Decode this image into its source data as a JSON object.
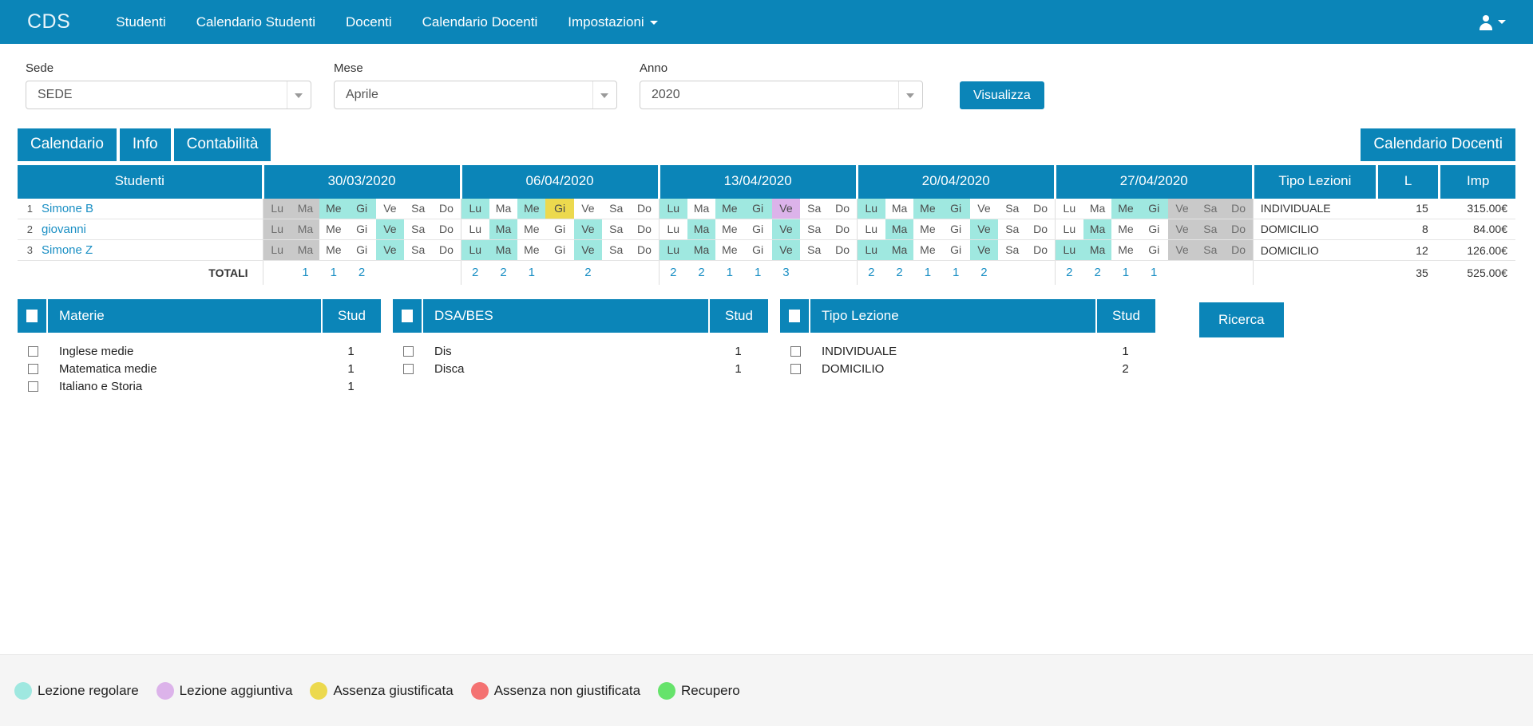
{
  "navbar": {
    "brand": "CDS",
    "links": [
      {
        "label": "Studenti",
        "caret": false
      },
      {
        "label": "Calendario Studenti",
        "caret": false
      },
      {
        "label": "Docenti",
        "caret": false
      },
      {
        "label": "Calendario Docenti",
        "caret": false
      },
      {
        "label": "Impostazioni",
        "caret": true
      }
    ],
    "user_icon": "user-icon"
  },
  "filters": {
    "sede": {
      "label": "Sede",
      "value": "SEDE"
    },
    "mese": {
      "label": "Mese",
      "value": "Aprile"
    },
    "anno": {
      "label": "Anno",
      "value": "2020"
    },
    "visualizza_label": "Visualizza"
  },
  "tabs": {
    "items": [
      {
        "label": "Calendario",
        "name": "tab-calendario"
      },
      {
        "label": "Info",
        "name": "tab-info"
      },
      {
        "label": "Contabilità",
        "name": "tab-contabilita"
      }
    ],
    "right_label": "Calendario Docenti"
  },
  "calendar": {
    "headers": {
      "studenti": "Studenti",
      "weeks": [
        "30/03/2020",
        "06/04/2020",
        "13/04/2020",
        "20/04/2020",
        "27/04/2020"
      ],
      "tipo": "Tipo Lezioni",
      "l": "L",
      "imp": "Imp"
    },
    "day_labels": [
      "Lu",
      "Ma",
      "Me",
      "Gi",
      "Ve",
      "Sa",
      "Do"
    ],
    "rows": [
      {
        "index": "1",
        "name": "Simone B",
        "tipo": "INDIVIDUALE",
        "l": "15",
        "imp": "315.00€",
        "weeks": [
          [
            "g",
            "g",
            "t",
            "t",
            "",
            "",
            ""
          ],
          [
            "t",
            "",
            "t",
            "y",
            "",
            "",
            ""
          ],
          [
            "t",
            "",
            "t",
            "t",
            "p",
            "",
            ""
          ],
          [
            "t",
            "",
            "t",
            "t",
            "",
            "",
            ""
          ],
          [
            "",
            "",
            "t",
            "t",
            "g",
            "g",
            "g"
          ]
        ]
      },
      {
        "index": "2",
        "name": "giovanni",
        "tipo": "DOMICILIO",
        "l": "8",
        "imp": "84.00€",
        "weeks": [
          [
            "g",
            "g",
            "",
            "",
            "t",
            "",
            ""
          ],
          [
            "",
            "t",
            "",
            "",
            "t",
            "",
            ""
          ],
          [
            "",
            "t",
            "",
            "",
            "t",
            "",
            ""
          ],
          [
            "",
            "t",
            "",
            "",
            "t",
            "",
            ""
          ],
          [
            "",
            "t",
            "",
            "",
            "g",
            "g",
            "g"
          ]
        ]
      },
      {
        "index": "3",
        "name": "Simone Z",
        "tipo": "DOMICILIO",
        "l": "12",
        "imp": "126.00€",
        "weeks": [
          [
            "g",
            "g",
            "",
            "",
            "t",
            "",
            ""
          ],
          [
            "t",
            "t",
            "",
            "",
            "t",
            "",
            ""
          ],
          [
            "t",
            "t",
            "",
            "",
            "t",
            "",
            ""
          ],
          [
            "t",
            "t",
            "",
            "",
            "t",
            "",
            ""
          ],
          [
            "t",
            "t",
            "",
            "",
            "g",
            "g",
            "g"
          ]
        ]
      }
    ],
    "totals": {
      "label": "TOTALI",
      "weeks": [
        [
          "",
          "1",
          "1",
          "2",
          "",
          "",
          ""
        ],
        [
          "2",
          "2",
          "1",
          "",
          "2",
          "",
          ""
        ],
        [
          "2",
          "2",
          "1",
          "1",
          "3",
          "",
          ""
        ],
        [
          "2",
          "2",
          "1",
          "1",
          "2",
          "",
          ""
        ],
        [
          "2",
          "2",
          "1",
          "1",
          "",
          "",
          ""
        ]
      ],
      "l": "35",
      "imp": "525.00€"
    }
  },
  "panels": [
    {
      "name": "materie",
      "title": "Materie",
      "stud_label": "Stud",
      "rows": [
        {
          "label": "Inglese medie",
          "count": "1"
        },
        {
          "label": "Matematica medie",
          "count": "1"
        },
        {
          "label": "Italiano e Storia",
          "count": "1"
        }
      ]
    },
    {
      "name": "dsa-bes",
      "title": "DSA/BES",
      "stud_label": "Stud",
      "rows": [
        {
          "label": "Dis",
          "count": "1"
        },
        {
          "label": "Disca",
          "count": "1"
        }
      ]
    },
    {
      "name": "tipo-lezione",
      "title": "Tipo Lezione",
      "stud_label": "Stud",
      "rows": [
        {
          "label": "INDIVIDUALE",
          "count": "1"
        },
        {
          "label": "DOMICILIO",
          "count": "2"
        }
      ]
    }
  ],
  "ricerca_label": "Ricerca",
  "legend": [
    {
      "label": "Lezione regolare",
      "color": "#9fe8e0"
    },
    {
      "label": "Lezione aggiuntiva",
      "color": "#dcb3ea"
    },
    {
      "label": "Assenza giustificata",
      "color": "#ecd94e"
    },
    {
      "label": "Assenza non giustificata",
      "color": "#f47272"
    },
    {
      "label": "Recupero",
      "color": "#66e36b"
    }
  ],
  "colors": {
    "brand": "#0B85B8",
    "link": "#1a8fc4",
    "weekend_gray": "#c9c9c9"
  }
}
